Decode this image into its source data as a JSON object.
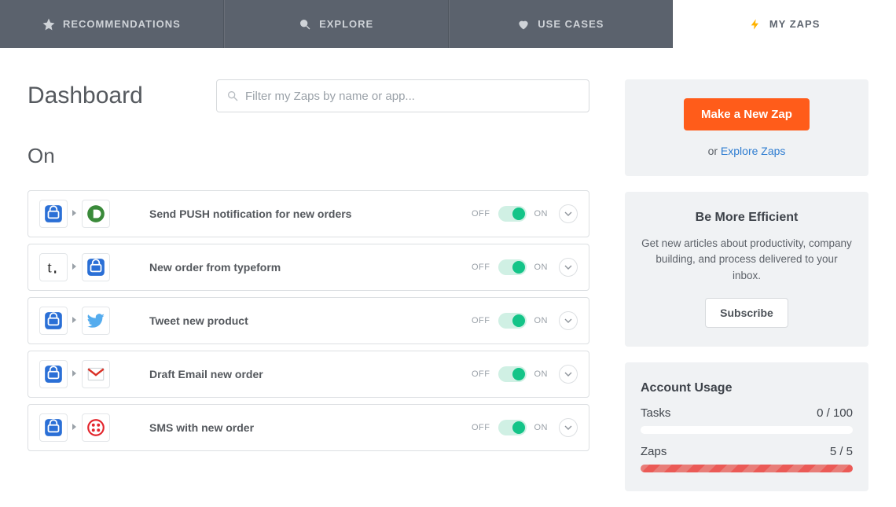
{
  "tabs": [
    {
      "label": "RECOMMENDATIONS",
      "icon": "star"
    },
    {
      "label": "EXPLORE",
      "icon": "search"
    },
    {
      "label": "USE CASES",
      "icon": "heart"
    },
    {
      "label": "MY ZAPS",
      "icon": "bolt",
      "active": true
    }
  ],
  "page": {
    "title": "Dashboard",
    "filter_placeholder": "Filter my Zaps by name or app...",
    "section": "On"
  },
  "labels": {
    "off": "OFF",
    "on": "ON"
  },
  "zaps": [
    {
      "name": "Send PUSH notification for new orders",
      "from": "vendhq",
      "to": "pushbullet",
      "on": true
    },
    {
      "name": "New order from typeform",
      "from": "typeform",
      "to": "vendhq",
      "on": true
    },
    {
      "name": "Tweet new product",
      "from": "vendhq",
      "to": "twitter",
      "on": true
    },
    {
      "name": "Draft Email new order",
      "from": "vendhq",
      "to": "gmail",
      "on": true
    },
    {
      "name": "SMS with new order",
      "from": "vendhq",
      "to": "twilio",
      "on": true
    }
  ],
  "cta": {
    "make": "Make a New Zap",
    "or": "or ",
    "explore": "Explore Zaps"
  },
  "efficient": {
    "title": "Be More Efficient",
    "body": "Get new articles about productivity, company building, and process delivered to your inbox.",
    "button": "Subscribe"
  },
  "usage": {
    "title": "Account Usage",
    "tasks_label": "Tasks",
    "tasks_value": "0 / 100",
    "tasks_frac": 0,
    "zaps_label": "Zaps",
    "zaps_value": "5 / 5",
    "zaps_frac": 1
  }
}
